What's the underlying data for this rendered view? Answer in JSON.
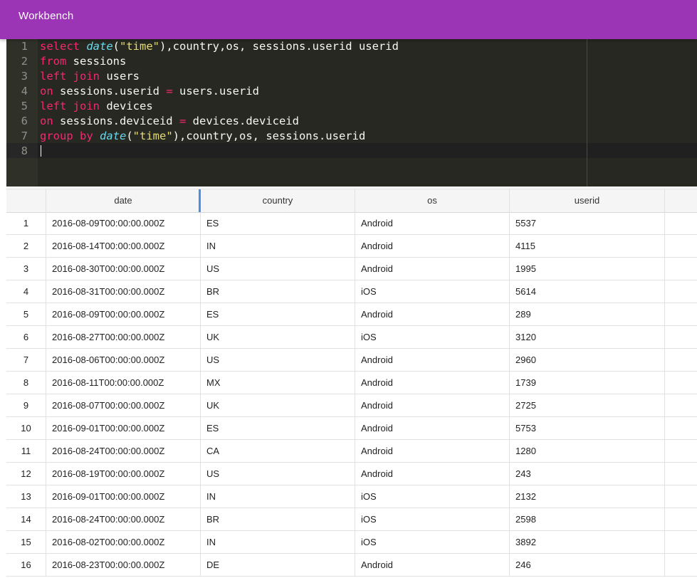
{
  "appbar": {
    "title": "Workbench"
  },
  "editor": {
    "lines": [
      {
        "n": "1",
        "tokens": [
          [
            "kw",
            "select"
          ],
          [
            "",
            " "
          ],
          [
            "fn",
            "date"
          ],
          [
            "",
            "("
          ],
          [
            "str",
            "\"time\""
          ],
          [
            "",
            "),country,os, sessions.userid userid"
          ]
        ]
      },
      {
        "n": "2",
        "tokens": [
          [
            "kw",
            "from"
          ],
          [
            "",
            " sessions"
          ]
        ]
      },
      {
        "n": "3",
        "tokens": [
          [
            "kw",
            "left join"
          ],
          [
            "",
            " users"
          ]
        ]
      },
      {
        "n": "4",
        "tokens": [
          [
            "kw",
            "on"
          ],
          [
            "",
            " sessions.userid "
          ],
          [
            "kw",
            "="
          ],
          [
            "",
            " users.userid"
          ]
        ]
      },
      {
        "n": "5",
        "tokens": [
          [
            "kw",
            "left join"
          ],
          [
            "",
            " devices"
          ]
        ]
      },
      {
        "n": "6",
        "tokens": [
          [
            "kw",
            "on"
          ],
          [
            "",
            " sessions.deviceid "
          ],
          [
            "kw",
            "="
          ],
          [
            "",
            " devices.deviceid"
          ]
        ]
      },
      {
        "n": "7",
        "tokens": [
          [
            "kw",
            "group by"
          ],
          [
            "",
            " "
          ],
          [
            "fn",
            "date"
          ],
          [
            "",
            "("
          ],
          [
            "str",
            "\"time\""
          ],
          [
            "",
            "),country,os, sessions.userid"
          ]
        ]
      },
      {
        "n": "8",
        "tokens": []
      }
    ]
  },
  "grid": {
    "columns": [
      "date",
      "country",
      "os",
      "userid"
    ],
    "rows": [
      {
        "n": "1",
        "date": "2016-08-09T00:00:00.000Z",
        "country": "ES",
        "os": "Android",
        "userid": "5537"
      },
      {
        "n": "2",
        "date": "2016-08-14T00:00:00.000Z",
        "country": "IN",
        "os": "Android",
        "userid": "4115"
      },
      {
        "n": "3",
        "date": "2016-08-30T00:00:00.000Z",
        "country": "US",
        "os": "Android",
        "userid": "1995"
      },
      {
        "n": "4",
        "date": "2016-08-31T00:00:00.000Z",
        "country": "BR",
        "os": "iOS",
        "userid": "5614"
      },
      {
        "n": "5",
        "date": "2016-08-09T00:00:00.000Z",
        "country": "ES",
        "os": "Android",
        "userid": "289"
      },
      {
        "n": "6",
        "date": "2016-08-27T00:00:00.000Z",
        "country": "UK",
        "os": "iOS",
        "userid": "3120"
      },
      {
        "n": "7",
        "date": "2016-08-06T00:00:00.000Z",
        "country": "US",
        "os": "Android",
        "userid": "2960"
      },
      {
        "n": "8",
        "date": "2016-08-11T00:00:00.000Z",
        "country": "MX",
        "os": "Android",
        "userid": "1739"
      },
      {
        "n": "9",
        "date": "2016-08-07T00:00:00.000Z",
        "country": "UK",
        "os": "Android",
        "userid": "2725"
      },
      {
        "n": "10",
        "date": "2016-09-01T00:00:00.000Z",
        "country": "ES",
        "os": "Android",
        "userid": "5753"
      },
      {
        "n": "11",
        "date": "2016-08-24T00:00:00.000Z",
        "country": "CA",
        "os": "Android",
        "userid": "1280"
      },
      {
        "n": "12",
        "date": "2016-08-19T00:00:00.000Z",
        "country": "US",
        "os": "Android",
        "userid": "243"
      },
      {
        "n": "13",
        "date": "2016-09-01T00:00:00.000Z",
        "country": "IN",
        "os": "iOS",
        "userid": "2132"
      },
      {
        "n": "14",
        "date": "2016-08-24T00:00:00.000Z",
        "country": "BR",
        "os": "iOS",
        "userid": "2598"
      },
      {
        "n": "15",
        "date": "2016-08-02T00:00:00.000Z",
        "country": "IN",
        "os": "iOS",
        "userid": "3892"
      },
      {
        "n": "16",
        "date": "2016-08-23T00:00:00.000Z",
        "country": "DE",
        "os": "Android",
        "userid": "246"
      }
    ]
  }
}
